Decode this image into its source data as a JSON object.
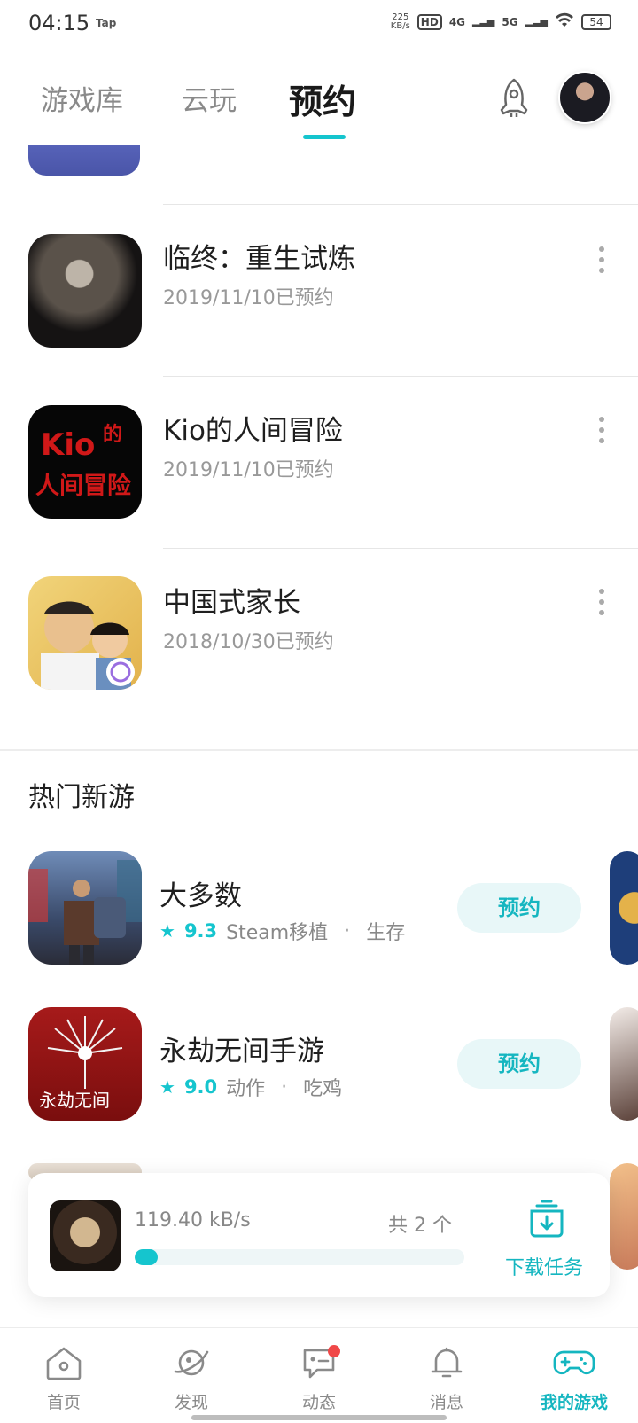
{
  "status_bar": {
    "time": "04:15",
    "tap_label": "Tap",
    "net_speed_value": "225",
    "net_speed_unit": "KB/s",
    "hd_label": "HD",
    "sig1": "4G",
    "sig2": "5G",
    "battery": "54"
  },
  "top_tabs": [
    {
      "label": "游戏库"
    },
    {
      "label": "云玩"
    },
    {
      "label": "预约"
    }
  ],
  "reserved": {
    "items": [
      {
        "title": "临终：重生试炼",
        "date": "2019/11/10已预约"
      },
      {
        "title": "Kio的人间冒险",
        "date": "2019/11/10已预约"
      },
      {
        "title": "中国式家长",
        "date": "2018/10/30已预约"
      }
    ]
  },
  "hot": {
    "section_title": "热门新游",
    "games": [
      {
        "title": "大多数",
        "score": "9.3",
        "tag1": "Steam移植",
        "tag2": "生存",
        "button": "预约"
      },
      {
        "title": "永劫无间手游",
        "score": "9.0",
        "tag1": "动作",
        "tag2": "吃鸡",
        "button": "预约"
      }
    ]
  },
  "download": {
    "speed": "119.40  kB/s",
    "count": "共  2  个",
    "progress": 0.07,
    "label": "下载任务"
  },
  "nav": [
    {
      "label": "首页"
    },
    {
      "label": "发现"
    },
    {
      "label": "动态"
    },
    {
      "label": "消息"
    },
    {
      "label": "我的游戏"
    }
  ],
  "colors": {
    "accent": "#15c5ce",
    "badge": "#f04848"
  }
}
